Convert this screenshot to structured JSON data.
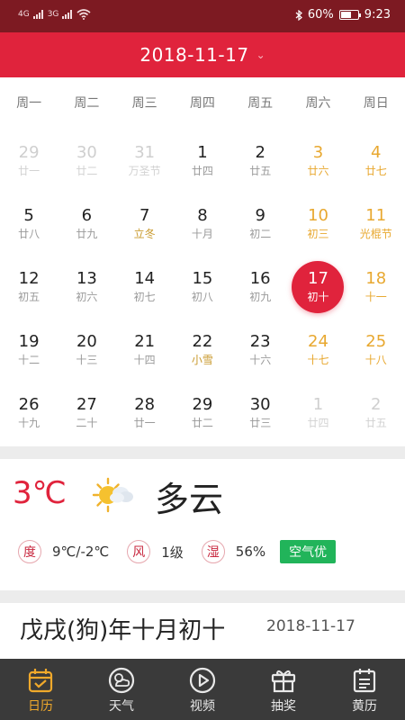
{
  "status_bar": {
    "signal1": "4G",
    "signal2": "3G",
    "battery": "60%",
    "battery_level": 0.6,
    "time": "9:23"
  },
  "header": {
    "date": "2018-11-17"
  },
  "weekdays": [
    "周一",
    "周二",
    "周三",
    "周四",
    "周五",
    "周六",
    "周日"
  ],
  "weeks": [
    [
      {
        "n": "29",
        "s": "廿一",
        "t": "faded"
      },
      {
        "n": "30",
        "s": "廿二",
        "t": "faded"
      },
      {
        "n": "31",
        "s": "万圣节",
        "t": "faded"
      },
      {
        "n": "1",
        "s": "廿四",
        "t": ""
      },
      {
        "n": "2",
        "s": "廿五",
        "t": ""
      },
      {
        "n": "3",
        "s": "廿六",
        "t": "weekend"
      },
      {
        "n": "4",
        "s": "廿七",
        "t": "weekend"
      }
    ],
    [
      {
        "n": "5",
        "s": "廿八",
        "t": ""
      },
      {
        "n": "6",
        "s": "廿九",
        "t": ""
      },
      {
        "n": "7",
        "s": "立冬",
        "t": "term"
      },
      {
        "n": "8",
        "s": "十月",
        "t": ""
      },
      {
        "n": "9",
        "s": "初二",
        "t": ""
      },
      {
        "n": "10",
        "s": "初三",
        "t": "weekend"
      },
      {
        "n": "11",
        "s": "光棍节",
        "t": "weekend"
      }
    ],
    [
      {
        "n": "12",
        "s": "初五",
        "t": ""
      },
      {
        "n": "13",
        "s": "初六",
        "t": ""
      },
      {
        "n": "14",
        "s": "初七",
        "t": ""
      },
      {
        "n": "15",
        "s": "初八",
        "t": ""
      },
      {
        "n": "16",
        "s": "初九",
        "t": ""
      },
      {
        "n": "17",
        "s": "初十",
        "t": "selected"
      },
      {
        "n": "18",
        "s": "十一",
        "t": "weekend"
      }
    ],
    [
      {
        "n": "19",
        "s": "十二",
        "t": ""
      },
      {
        "n": "20",
        "s": "十三",
        "t": ""
      },
      {
        "n": "21",
        "s": "十四",
        "t": ""
      },
      {
        "n": "22",
        "s": "小雪",
        "t": "term"
      },
      {
        "n": "23",
        "s": "十六",
        "t": ""
      },
      {
        "n": "24",
        "s": "十七",
        "t": "weekend"
      },
      {
        "n": "25",
        "s": "十八",
        "t": "weekend"
      }
    ],
    [
      {
        "n": "26",
        "s": "十九",
        "t": ""
      },
      {
        "n": "27",
        "s": "二十",
        "t": ""
      },
      {
        "n": "28",
        "s": "廿一",
        "t": ""
      },
      {
        "n": "29",
        "s": "廿二",
        "t": ""
      },
      {
        "n": "30",
        "s": "廿三",
        "t": ""
      },
      {
        "n": "1",
        "s": "廿四",
        "t": "faded"
      },
      {
        "n": "2",
        "s": "廿五",
        "t": "faded"
      }
    ]
  ],
  "weather": {
    "temperature": "3℃",
    "icon": "partly-cloudy-icon",
    "description": "多云",
    "range_label": "度",
    "range": "9℃/-2℃",
    "wind_label": "风",
    "wind": "1级",
    "humidity_label": "湿",
    "humidity": "56%",
    "air_quality": "空气优"
  },
  "lunar": {
    "text": "戊戌(狗)年十月初十",
    "date": "2018-11-17"
  },
  "tabs": [
    {
      "label": "日历",
      "icon": "calendar-icon",
      "active": true
    },
    {
      "label": "天气",
      "icon": "weather-icon",
      "active": false
    },
    {
      "label": "视频",
      "icon": "play-icon",
      "active": false
    },
    {
      "label": "抽奖",
      "icon": "gift-icon",
      "active": false
    },
    {
      "label": "黄历",
      "icon": "almanac-icon",
      "active": false
    }
  ],
  "colors": {
    "status_bar": "#7d1a22",
    "header": "#e0233c",
    "accent": "#e0233c",
    "weekend": "#e8a830",
    "tab_active": "#f0a92b",
    "tab_bar": "#3a3a3a",
    "aqi_good": "#21b45a"
  }
}
